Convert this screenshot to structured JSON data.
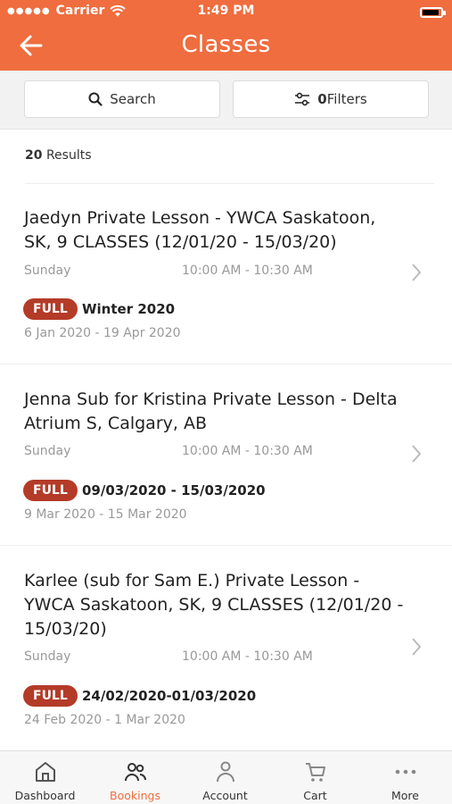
{
  "status_bar": {
    "carrier": "Carrier",
    "time": "1:49 PM",
    "battery_level": 0.9
  },
  "header": {
    "title": "Classes",
    "back_icon": "arrow-left-icon"
  },
  "toolbar": {
    "search_label": "Search",
    "filters_count": "0",
    "filters_label": "Filters"
  },
  "results": {
    "count": "20",
    "label": "Results"
  },
  "classes": [
    {
      "title": "Jaedyn Private Lesson - YWCA Saskatoon, SK, 9 CLASSES (12/01/20 - 15/03/20)",
      "day": "Sunday",
      "time": "10:00 AM - 10:30 AM",
      "status": "FULL",
      "session": "Winter 2020",
      "dates": "6 Jan 2020 - 19 Apr 2020"
    },
    {
      "title": "Jenna Sub for Kristina Private Lesson - Delta Atrium S, Calgary, AB",
      "day": "Sunday",
      "time": "10:00 AM - 10:30 AM",
      "status": "FULL",
      "session": "09/03/2020 - 15/03/2020",
      "dates": "9 Mar 2020 - 15 Mar 2020"
    },
    {
      "title": "Karlee (sub for Sam E.) Private Lesson - YWCA Saskatoon, SK, 9 CLASSES (12/01/20 - 15/03/20)",
      "day": "Sunday",
      "time": "10:00 AM - 10:30 AM",
      "status": "FULL",
      "session": "24/02/2020-01/03/2020",
      "dates": "24 Feb 2020 - 1 Mar 2020"
    }
  ],
  "tabbar": {
    "items": [
      {
        "label": "Dashboard",
        "icon": "house-icon"
      },
      {
        "label": "Bookings",
        "icon": "people-icon",
        "active": true
      },
      {
        "label": "Account",
        "icon": "person-icon"
      },
      {
        "label": "Cart",
        "icon": "cart-icon"
      },
      {
        "label": "More",
        "icon": "more-dots-icon"
      }
    ]
  },
  "colors": {
    "brand": "#ef6d3f",
    "badge_full": "#b43b28",
    "muted_text": "#999999"
  }
}
